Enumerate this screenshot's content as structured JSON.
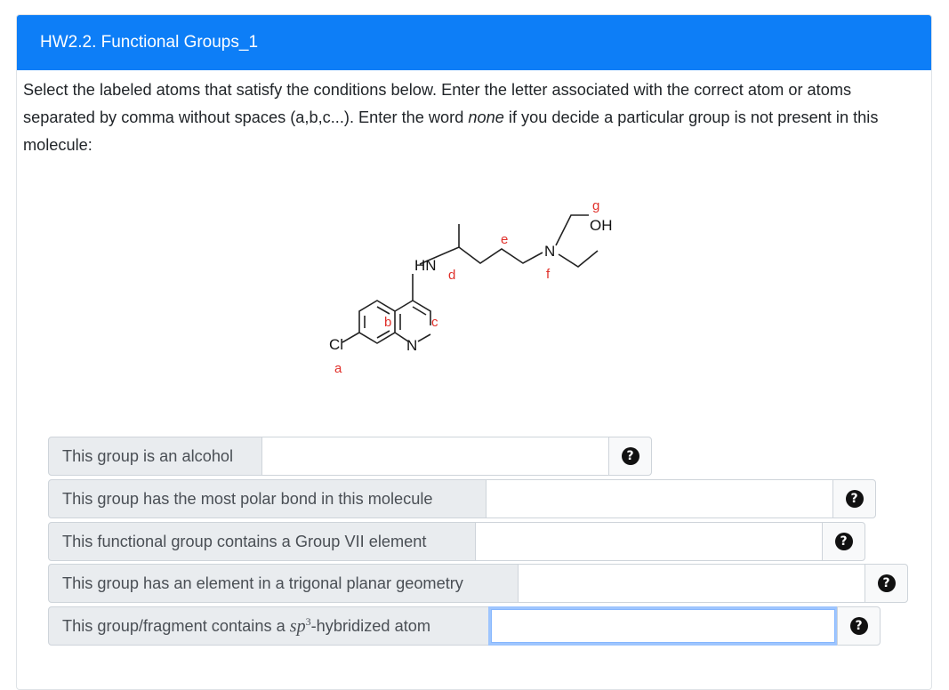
{
  "header": {
    "title": "HW2.2. Functional Groups_1"
  },
  "prompt": {
    "part1": "Select the labeled atoms that satisfy the conditions below. Enter the letter associated with the correct atom or atoms separated by comma without spaces (a,b,c...). Enter the word ",
    "emphasis": "none",
    "part2": " if you decide a particular group is not present in this molecule:"
  },
  "molecule": {
    "atoms": {
      "cl": "Cl",
      "hn": "HN",
      "n_ring": "N",
      "n_amine": "N",
      "oh": "OH"
    },
    "letters": {
      "a": "a",
      "b": "b",
      "c": "c",
      "d": "d",
      "e": "e",
      "f": "f",
      "g": "g"
    }
  },
  "questions": [
    {
      "label": "This group is an alcohol",
      "value": ""
    },
    {
      "label": "This group has the most polar bond in this molecule",
      "value": ""
    },
    {
      "label": "This functional group contains a Group VII element",
      "value": ""
    },
    {
      "label": "This group has an element in a trigonal planar geometry",
      "value": ""
    },
    {
      "label_pre": "This group/fragment contains a ",
      "label_sp": "sp",
      "label_sup": "3",
      "label_post": "-hybridized atom",
      "value": ""
    }
  ],
  "help_icon": "question-circle-icon"
}
